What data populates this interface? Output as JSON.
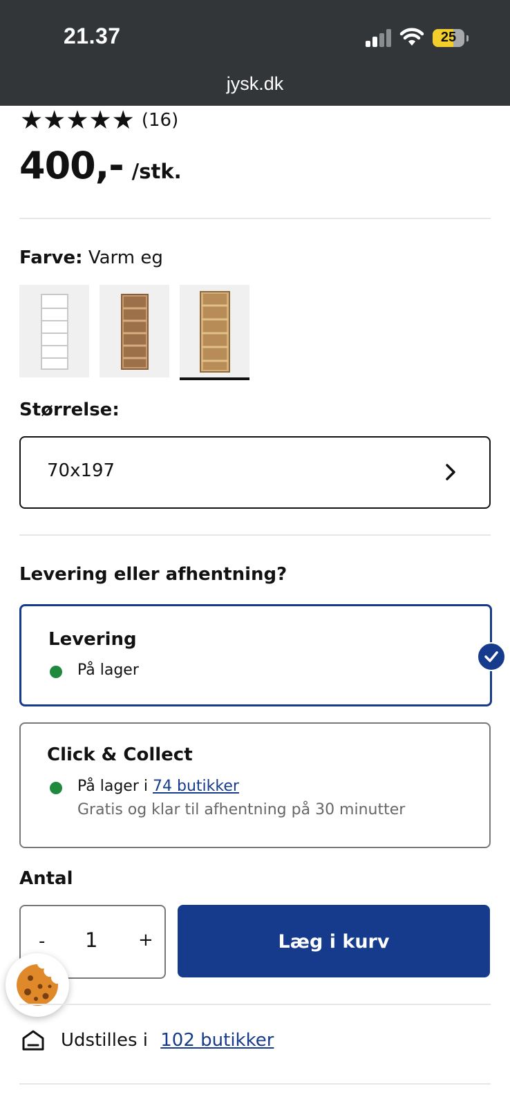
{
  "status_bar": {
    "time": "21.37",
    "battery": "25",
    "url": "jysk.dk"
  },
  "rating": {
    "stars": "★★★★★",
    "count": "(16)"
  },
  "price": {
    "value": "400,-",
    "unit": "/stk."
  },
  "color": {
    "label": "Farve:",
    "value": "Varm eg",
    "swatches": [
      "white",
      "oak-light",
      "warm-oak"
    ],
    "selected_index": 2
  },
  "size": {
    "label": "Størrelse:",
    "value": "70x197"
  },
  "delivery": {
    "heading": "Levering eller afhentning?",
    "options": [
      {
        "title": "Levering",
        "status": "På lager",
        "selected": true
      },
      {
        "title": "Click & Collect",
        "status_prefix": "På lager i ",
        "status_link": "74 butikker",
        "note": "Gratis og klar til afhentning på 30 minutter",
        "selected": false
      }
    ]
  },
  "quantity": {
    "label": "Antal",
    "minus": "-",
    "value": "1",
    "plus": "+"
  },
  "cart": {
    "button_label": "Læg i kurv"
  },
  "display_stores": {
    "prefix": "Udstilles i ",
    "link": "102 butikker"
  },
  "colors": {
    "brand_blue": "#163b8c",
    "in_stock_green": "#1f8a3b",
    "status_bar_bg": "#333638"
  },
  "icons": [
    "signal-icon",
    "wifi-icon",
    "battery-icon",
    "chevron-right-icon",
    "check-icon",
    "cookie-icon",
    "store-icon"
  ]
}
